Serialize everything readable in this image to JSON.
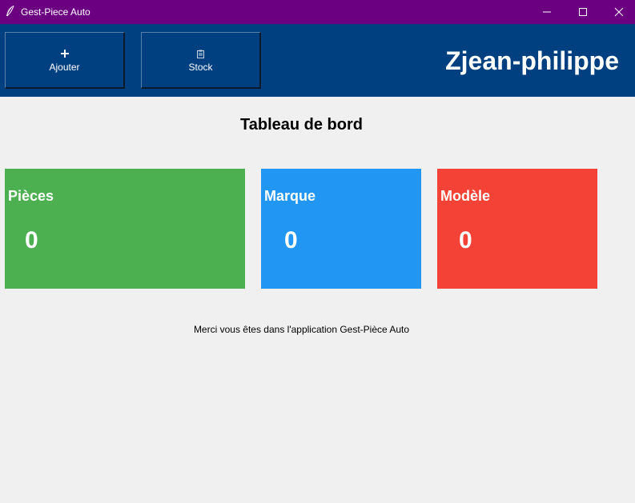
{
  "window": {
    "title": "Gest-Piece Auto"
  },
  "toolbar": {
    "add_label": "Ajouter",
    "stock_label": "Stock",
    "user_name": "Zjean-philippe"
  },
  "dashboard": {
    "title": "Tableau de bord",
    "cards": [
      {
        "label": "Pièces",
        "value": "0",
        "color": "#4caf50"
      },
      {
        "label": "Marque",
        "value": "0",
        "color": "#2196f3"
      },
      {
        "label": "Modèle",
        "value": "0",
        "color": "#f44336"
      }
    ],
    "footer_message": "Merci vous êtes dans l'application Gest-Pièce Auto"
  },
  "colors": {
    "titlebar": "#6b0080",
    "toolbar": "#004080",
    "background": "#f0f0f0"
  },
  "icons": {
    "app": "feather-icon",
    "add": "plus-icon",
    "stock": "clipboard-icon"
  }
}
